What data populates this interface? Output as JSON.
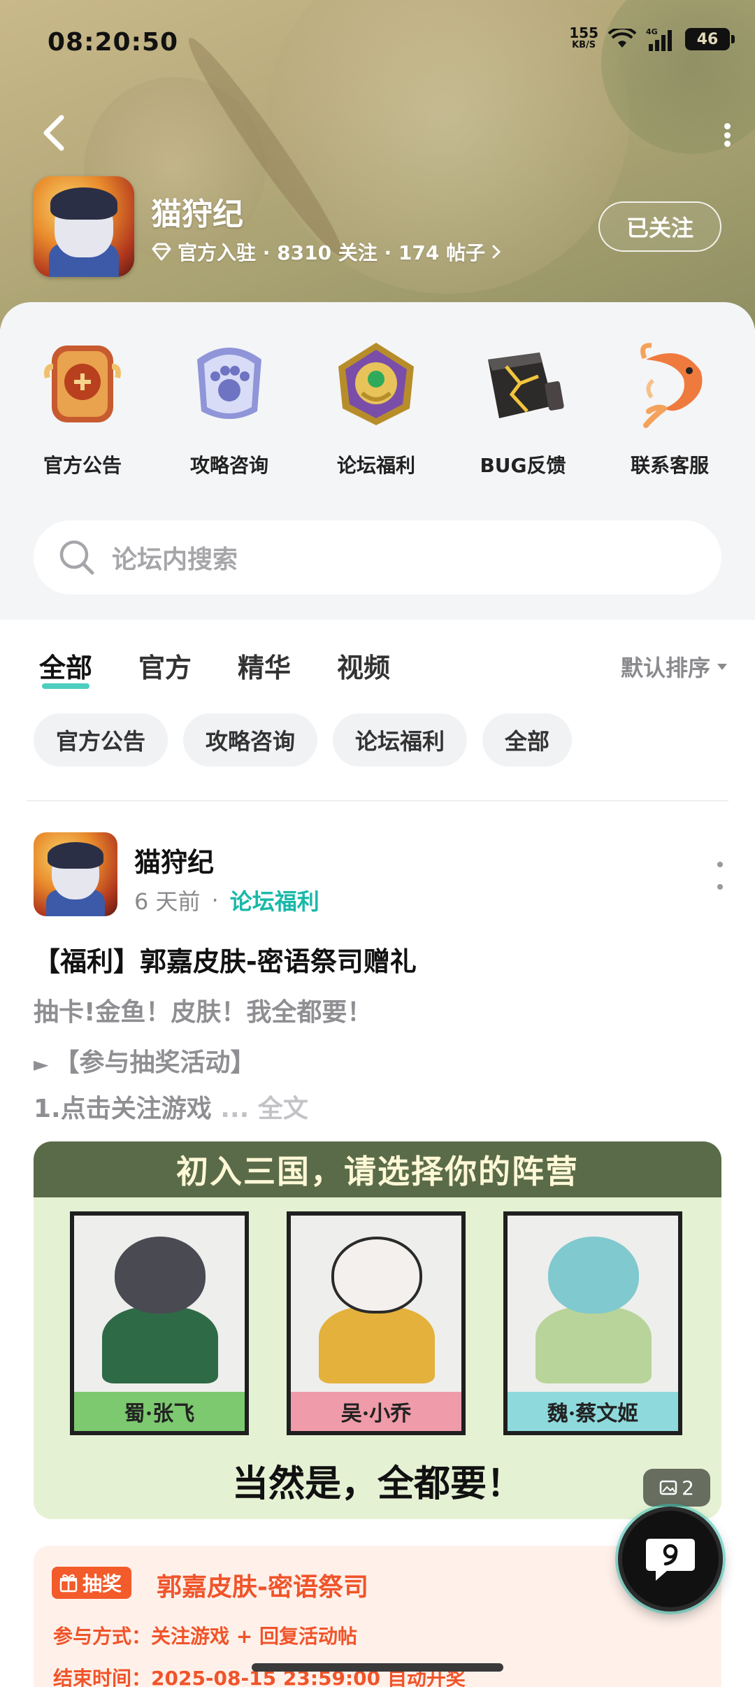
{
  "status_bar": {
    "time": "08:20:50",
    "speed_value": "155",
    "speed_unit": "KB/S",
    "network": "4G",
    "battery": "46"
  },
  "header": {
    "game_name": "猫狩纪",
    "meta": "官方入驻 · 8310 关注 · 174 帖子",
    "follow_label": "已关注"
  },
  "quick_links": [
    {
      "label": "官方公告",
      "icon": "bulletin-badge-icon"
    },
    {
      "label": "攻略咨询",
      "icon": "paw-badge-icon"
    },
    {
      "label": "论坛福利",
      "icon": "gem-medallion-icon"
    },
    {
      "label": "BUG反馈",
      "icon": "cracked-stone-icon"
    },
    {
      "label": "联系客服",
      "icon": "koi-fish-icon"
    }
  ],
  "search": {
    "placeholder": "论坛内搜索"
  },
  "feed": {
    "tabs": [
      {
        "label": "全部",
        "active": true
      },
      {
        "label": "官方"
      },
      {
        "label": "精华"
      },
      {
        "label": "视频"
      }
    ],
    "sort_label": "默认排序",
    "chips": [
      "官方公告",
      "攻略咨询",
      "论坛福利",
      "全部"
    ],
    "post": {
      "author": "猫狩纪",
      "time": "6 天前",
      "dot": "·",
      "category": "论坛福利",
      "title": "【福利】郭嘉皮肤-密语祭司赠礼",
      "line1": "抽卡!金鱼！皮肤！我全都要！",
      "line2_arrow": "►",
      "line2": "【参与抽奖活动】",
      "line3": "1.点击关注游戏",
      "line3_more": " ... 全文",
      "image": {
        "headline": "初入三国，请选择你的阵营",
        "cards": [
          "蜀·张飞",
          "吴·小乔",
          "魏·蔡文姬"
        ],
        "footer": "当然是，全都要！",
        "count": "2"
      },
      "lottery": {
        "badge": "抽奖",
        "title": "郭嘉皮肤-密语祭司",
        "join": "参与方式：关注游戏 + 回复活动帖",
        "end": "结束时间：2025-08-15 23:59:00 自动开奖"
      }
    }
  },
  "colors": {
    "accent": "#2ec6b6",
    "category": "#19b8a8",
    "lottery": "#f0542a"
  }
}
